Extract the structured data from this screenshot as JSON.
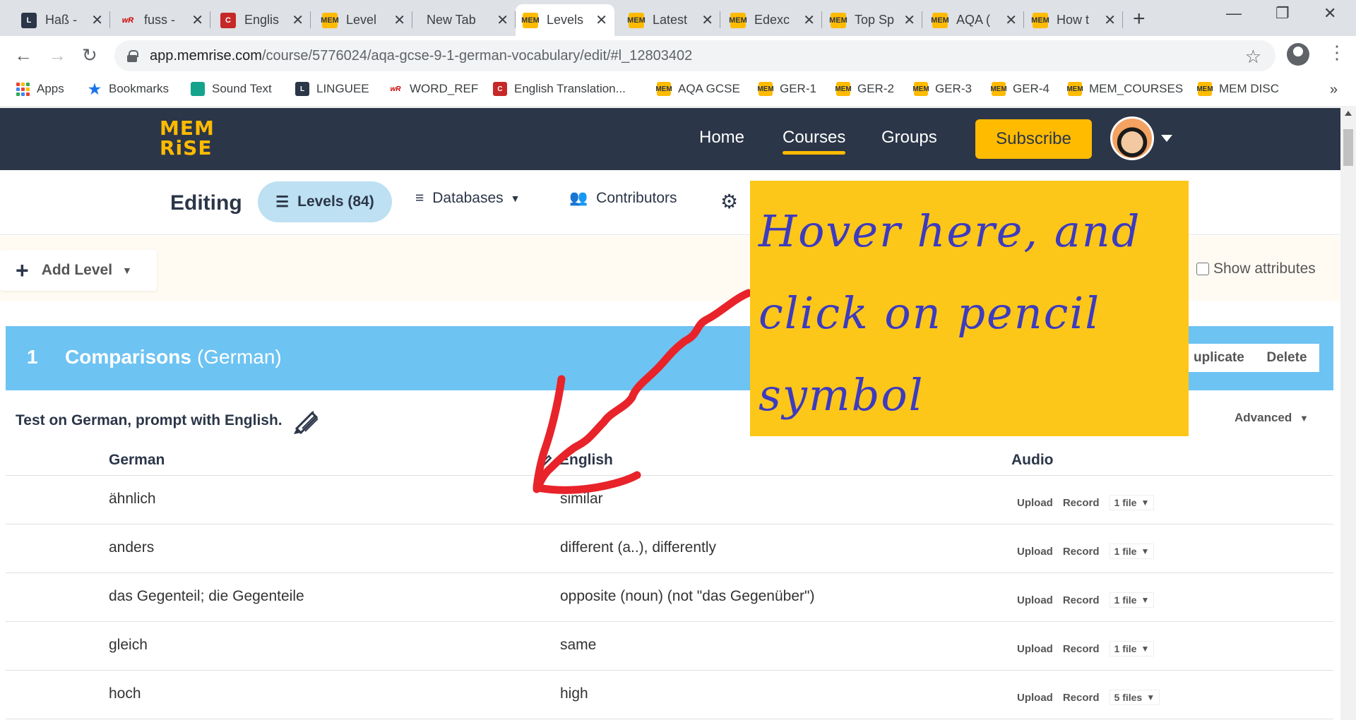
{
  "browser": {
    "tabs": [
      {
        "title": "Haß -",
        "icon": "linguee-icon"
      },
      {
        "title": "fuss -",
        "icon": "wordref-icon"
      },
      {
        "title": "Englis",
        "icon": "collins-icon"
      },
      {
        "title": "Level",
        "icon": "memrise-icon"
      },
      {
        "title": "New Tab",
        "icon": ""
      },
      {
        "title": "Levels",
        "icon": "memrise-icon",
        "active": true
      },
      {
        "title": "Latest",
        "icon": "memrise-icon"
      },
      {
        "title": "Edexc",
        "icon": "memrise-icon"
      },
      {
        "title": "Top Sp",
        "icon": "memrise-icon"
      },
      {
        "title": "AQA (",
        "icon": "memrise-icon"
      },
      {
        "title": "How t",
        "icon": "memrise-icon"
      }
    ],
    "url": {
      "host": "app.memrise.com",
      "path": "/course/5776024/aqa-gcse-9-1-german-vocabulary/edit/#l_12803402"
    },
    "bookmarks": [
      {
        "label": "Apps",
        "icon": "apps-icon"
      },
      {
        "label": "Bookmarks",
        "icon": "star-icon"
      },
      {
        "label": "Sound Text",
        "icon": "sound-text-icon"
      },
      {
        "label": "LINGUEE",
        "icon": "linguee-icon"
      },
      {
        "label": "WORD_REF",
        "icon": "wordref-icon"
      },
      {
        "label": "English Translation...",
        "icon": "collins-icon"
      },
      {
        "label": "AQA GCSE",
        "icon": "memrise-icon"
      },
      {
        "label": "GER-1",
        "icon": "memrise-icon"
      },
      {
        "label": "GER-2",
        "icon": "memrise-icon"
      },
      {
        "label": "GER-3",
        "icon": "memrise-icon"
      },
      {
        "label": "GER-4",
        "icon": "memrise-icon"
      },
      {
        "label": "MEM_COURSES",
        "icon": "memrise-icon"
      },
      {
        "label": "MEM DISC",
        "icon": "memrise-icon"
      }
    ],
    "favicon_text": {
      "wr": "wR",
      "collins": "C",
      "memrise": "MEM"
    }
  },
  "site": {
    "logo": {
      "line1": "MEM",
      "line2": "RiSE"
    },
    "nav": {
      "home": "Home",
      "courses": "Courses",
      "groups": "Groups",
      "subscribe": "Subscribe"
    },
    "colors": {
      "navy": "#2b3648",
      "yellow": "#ffbb00",
      "level_blue": "#6dc3f2",
      "pill_blue": "#bde0f2"
    }
  },
  "editor": {
    "editing": "Editing",
    "levels_tab": "Levels (84)",
    "databases_tab": "Databases",
    "contributors_tab": "Contributors",
    "add_level": "Add Level",
    "show_attributes": "Show attributes",
    "level": {
      "number": "1",
      "name": "Comparisons",
      "language": "(German)",
      "duplicate": "uplicate",
      "delete": "Delete",
      "test_line": "Test on German, prompt with English.",
      "advanced": "Advanced",
      "columns": {
        "german": "German",
        "english": "English",
        "audio": "Audio"
      },
      "audio_actions": {
        "upload": "Upload",
        "record": "Record"
      },
      "rows": [
        {
          "german": "ähnlich",
          "english": "similar",
          "files": "1 file"
        },
        {
          "german": "anders",
          "english": "different (a..), differently",
          "files": "1 file"
        },
        {
          "german": "das Gegenteil; die Gegenteile",
          "english": "opposite (noun) (not \"das Gegenüber\")",
          "files": "1 file"
        },
        {
          "german": "gleich",
          "english": "same",
          "files": "1 file"
        },
        {
          "german": "hoch",
          "english": "high",
          "files": "5 files"
        }
      ]
    }
  },
  "annotation": {
    "lines": [
      "Hover here, and",
      "click on pencil",
      "symbol"
    ],
    "note_color": "#fdc719",
    "text_color": "#3d3bbf",
    "arrow_color": "#e8232a"
  }
}
